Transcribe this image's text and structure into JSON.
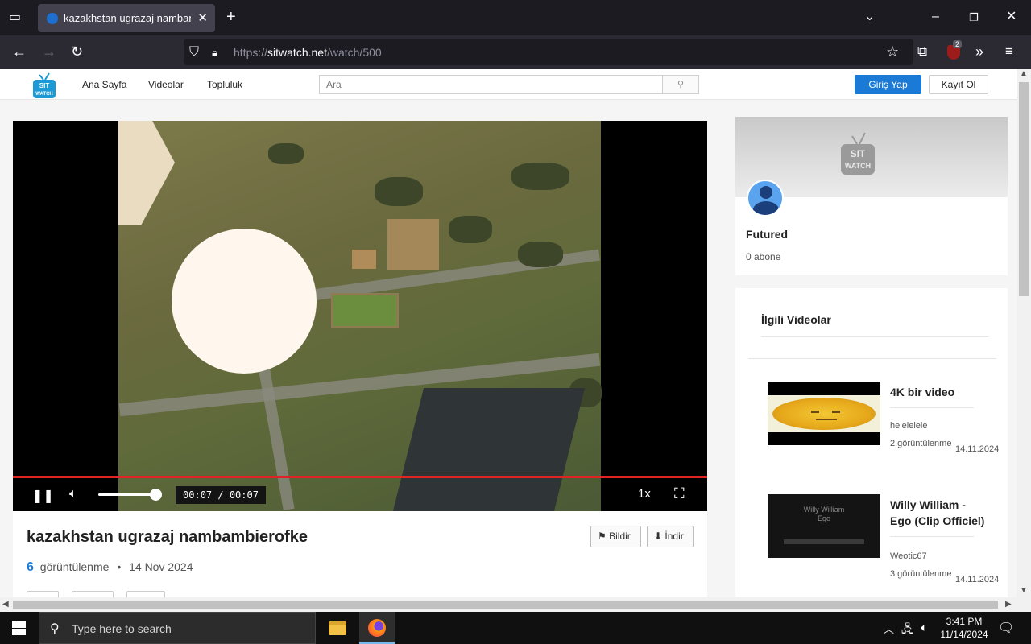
{
  "browser": {
    "tab_title": "kazakhstan ugrazaj nambambierofke",
    "url_prefix": "https://",
    "url_domain": "sitwatch.net",
    "url_path": "/watch/500",
    "extension_badge": "2"
  },
  "site": {
    "logo_text": "SIT WATCH",
    "nav": [
      "Ana Sayfa",
      "Videolar",
      "Topluluk"
    ],
    "search_placeholder": "Ara",
    "login_label": "Giriş Yap",
    "register_label": "Kayıt Ol"
  },
  "player": {
    "time_display": "00:07 / 00:07",
    "speed": "1x",
    "progress": 1.0,
    "volume": 0.85
  },
  "video": {
    "title": "kazakhstan ugrazaj nambambierofke",
    "report_label": "Bildir",
    "download_label": "İndir",
    "views_count": "6",
    "views_label": "görüntülenme",
    "separator": "•",
    "date": "14 Nov 2024"
  },
  "channel": {
    "name": "Futured",
    "subscribers": "0 abone"
  },
  "related": {
    "heading": "İlgili Videolar",
    "items": [
      {
        "title": "4K bir video",
        "author": "helelelele",
        "views": "2 görüntülenme",
        "date": "14.11.2024",
        "thumb_text": ""
      },
      {
        "title": "Willy William - Ego (Clip Officiel)",
        "author": "Weotic67",
        "views": "3 görüntülenme",
        "date": "14.11.2024",
        "thumb_text": "Willy William Ego"
      }
    ]
  },
  "taskbar": {
    "search_placeholder": "Type here to search",
    "time": "3:41 PM",
    "date": "11/14/2024"
  }
}
